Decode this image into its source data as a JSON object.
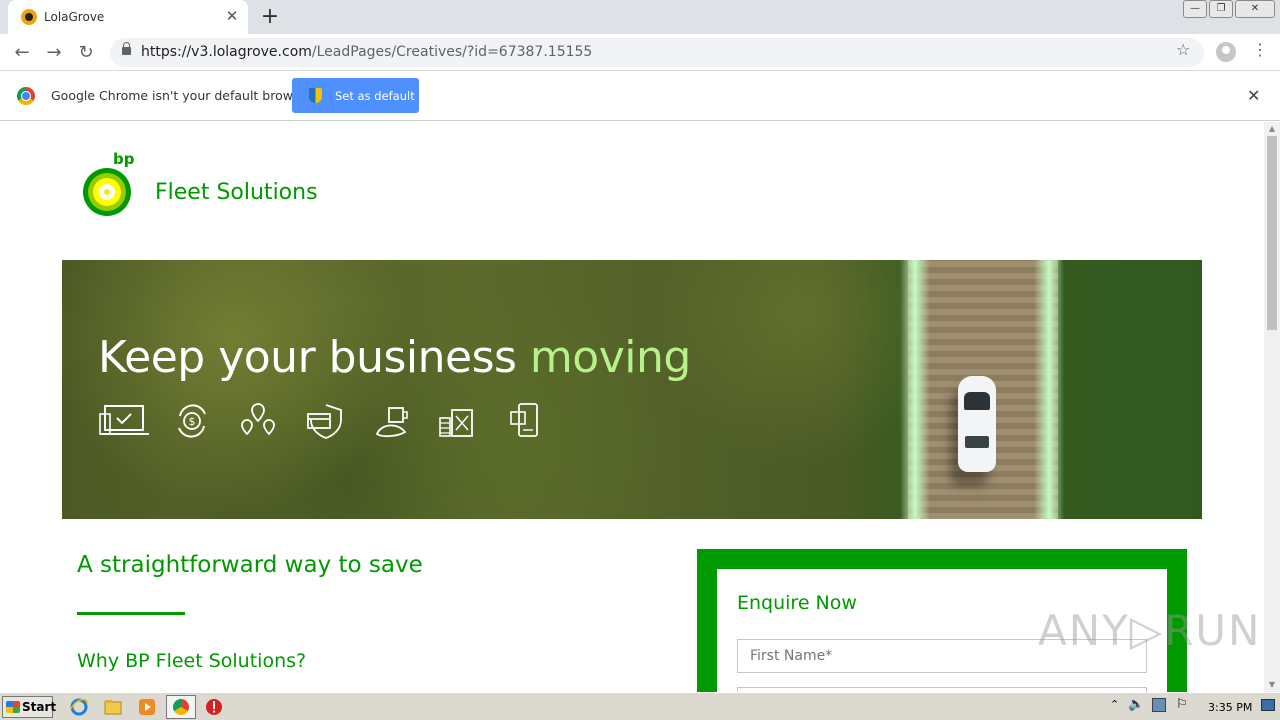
{
  "browser": {
    "tab_title": "LolaGrove",
    "tab_close": "✕",
    "new_tab": "+",
    "url_host": "https://v3.lolagrove.com",
    "url_path": "/LeadPages/Creatives/?id=67387.15155",
    "window_controls": [
      "—",
      "❐",
      "✕"
    ]
  },
  "infobar": {
    "message": "Google Chrome isn't your default browser",
    "button_label": "Set as default",
    "close": "✕"
  },
  "brand": {
    "bp": "bp",
    "name": "Fleet Solutions",
    "color": "#009900"
  },
  "hero": {
    "title_main": "Keep your business ",
    "title_accent": "moving",
    "icons": [
      "laptop-icon",
      "dollar-cycle-icon",
      "location-pins-icon",
      "card-shield-icon",
      "coffee-croissant-icon",
      "fuel-can-icon",
      "mobile-devices-icon"
    ]
  },
  "content": {
    "heading": "A straightforward way to save",
    "subheading": "Why BP Fleet Solutions?"
  },
  "form": {
    "title": "Enquire Now",
    "first_name_placeholder": "First Name*"
  },
  "watermark": "ANY▷RUN",
  "taskbar": {
    "start_label": "Start",
    "clock": "3:35 PM"
  }
}
